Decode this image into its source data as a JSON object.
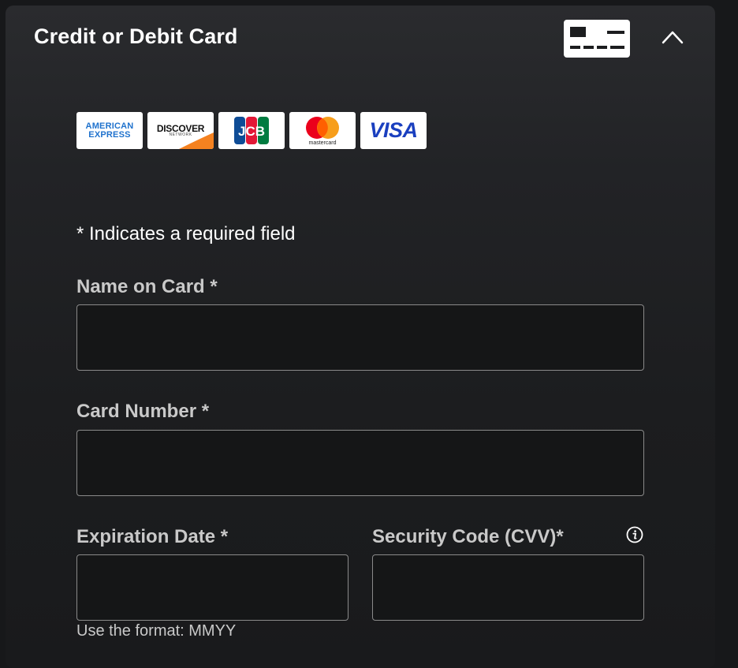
{
  "header": {
    "title": "Credit or Debit Card",
    "card_icon": "credit-card-icon",
    "collapse_icon": "chevron-up-icon"
  },
  "card_logos": [
    {
      "name": "american-express-logo",
      "line1": "AMERICAN",
      "line2": "EXPRESS"
    },
    {
      "name": "discover-logo",
      "text": "DISCOVER",
      "sub": "NETWORK"
    },
    {
      "name": "jcb-logo",
      "text": "JCB"
    },
    {
      "name": "mastercard-logo",
      "text": "mastercard"
    },
    {
      "name": "visa-logo",
      "text": "VISA"
    }
  ],
  "form": {
    "required_note": "* Indicates a required field",
    "name_on_card": {
      "label": "Name on Card *",
      "value": ""
    },
    "card_number": {
      "label": "Card Number *",
      "value": ""
    },
    "expiration_date": {
      "label": "Expiration Date *",
      "value": "",
      "hint": "Use the format: MMYY"
    },
    "security_code": {
      "label": "Security Code (CVV)*",
      "value": "",
      "info_icon": "info-icon"
    }
  },
  "colors": {
    "background": "#1c1d1f",
    "text_primary": "#ffffff",
    "label": "#c9c9c9",
    "input_border": "#8a8a8a",
    "amex_blue": "#1f72cd",
    "visa_blue": "#1a3fbf",
    "mastercard_red": "#eb001b",
    "mastercard_orange": "#f79e1b",
    "discover_orange": "#f58220"
  }
}
